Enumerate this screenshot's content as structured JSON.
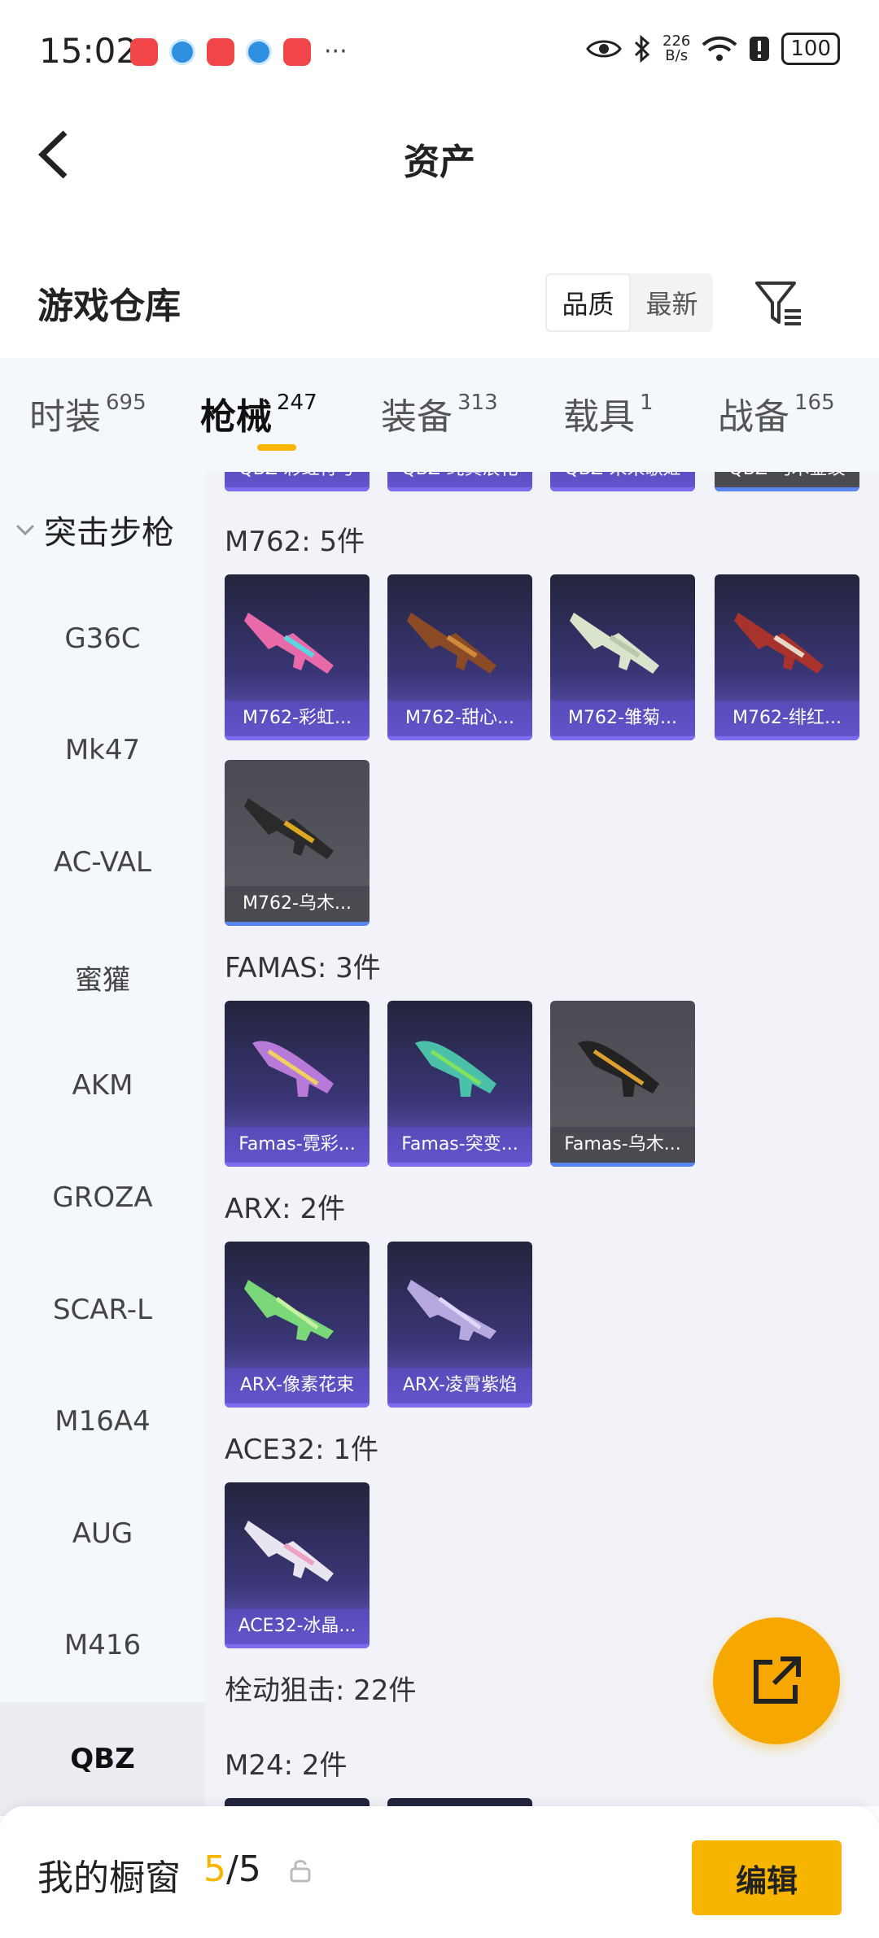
{
  "status": {
    "time": "15:02",
    "dots": "···",
    "net_speed_value": "226",
    "net_speed_unit": "B/s",
    "battery": "100"
  },
  "nav": {
    "title": "资产"
  },
  "repo": {
    "title": "游戏仓库",
    "sort_options": [
      "品质",
      "最新"
    ],
    "active_sort": "品质"
  },
  "category_tabs": [
    {
      "label": "时装",
      "count": "695"
    },
    {
      "label": "枪械",
      "count": "247"
    },
    {
      "label": "装备",
      "count": "313"
    },
    {
      "label": "载具",
      "count": "1"
    },
    {
      "label": "战备",
      "count": "165"
    }
  ],
  "sidebar": {
    "group": "突击步枪",
    "items": [
      "G36C",
      "Mk47",
      "AC-VAL",
      "蜜獾",
      "AKM",
      "GROZA",
      "SCAR-L",
      "M16A4",
      "AUG",
      "M416",
      "QBZ"
    ],
    "selected": "QBZ"
  },
  "content": {
    "top_partial": [
      "QBZ-彩虹符号",
      "QBZ-纯真浪花",
      "QBZ-未来歌姬",
      "QBZ-乌木金纹"
    ],
    "sections": [
      {
        "title": "M762: 5件",
        "items": [
          {
            "name": "M762-彩虹...",
            "tier": "purple"
          },
          {
            "name": "M762-甜心...",
            "tier": "purple"
          },
          {
            "name": "M762-雏菊...",
            "tier": "purple"
          },
          {
            "name": "M762-绯红...",
            "tier": "purple"
          },
          {
            "name": "M762-乌木...",
            "tier": "gray"
          }
        ]
      },
      {
        "title": "FAMAS: 3件",
        "items": [
          {
            "name": "Famas-霓彩...",
            "tier": "purple"
          },
          {
            "name": "Famas-突变...",
            "tier": "purple"
          },
          {
            "name": "Famas-乌木...",
            "tier": "gray"
          }
        ]
      },
      {
        "title": "ARX: 2件",
        "items": [
          {
            "name": "ARX-像素花束",
            "tier": "purple"
          },
          {
            "name": "ARX-凌霄紫焰",
            "tier": "purple"
          }
        ]
      },
      {
        "title": "ACE32: 1件",
        "items": [
          {
            "name": "ACE32-冰晶...",
            "tier": "purple"
          }
        ]
      }
    ],
    "category_heading": "栓动狙击: 22件",
    "sub_heading": "M24: 2件"
  },
  "bottom": {
    "label": "我的橱窗",
    "current": "5",
    "separator": "/",
    "total": "5",
    "edit_label": "编辑"
  },
  "colors": {
    "accent": "#f7b500",
    "fab": "#f7a800",
    "purple_card": "#3a3676"
  }
}
